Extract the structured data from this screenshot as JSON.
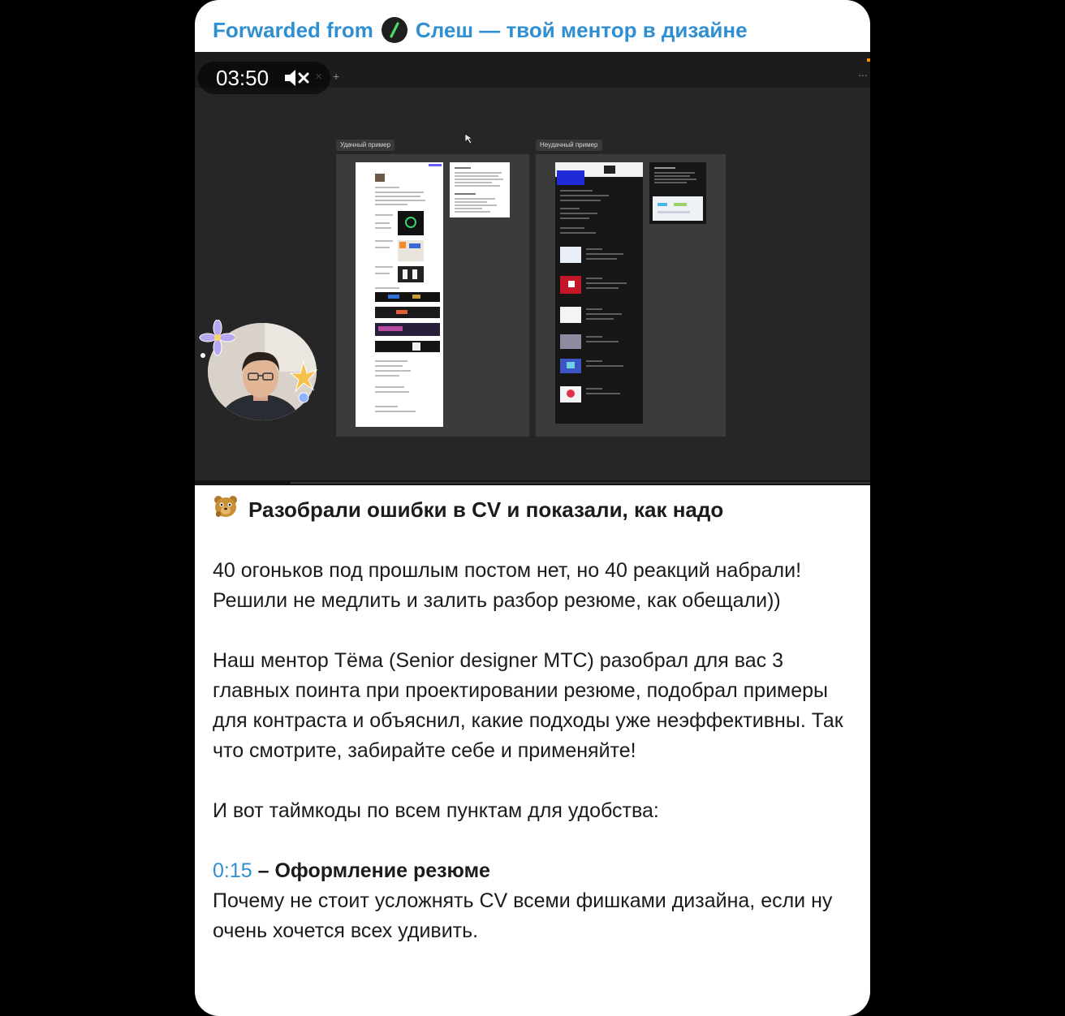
{
  "forward": {
    "prefix": "Forwarded from",
    "channel": "Слеш — твой ментор в дизайне",
    "avatar_icon": "slash-icon"
  },
  "video": {
    "duration": "03:50",
    "muted": true,
    "mute_icon": "speaker-muted-icon",
    "frames": [
      {
        "label": "Удачный пример"
      },
      {
        "label": "Неудачный пример"
      }
    ]
  },
  "post": {
    "emoji_icon": "bear-emoji-icon",
    "title": "Разобрали ошибки в CV и показали, как надо",
    "paragraph1": "40 огоньков под прошлым постом нет, но 40 реакций набрали! Решили не медлить и залить разбор резюме, как обещали))",
    "paragraph2": "Наш ментор Тёма (Senior designer МТС) разобрал для вас 3 главных поинта при проектировании резюме, подобрал примеры для контраста и объяснил, какие подходы уже неэффективны. Так что смотрите, забирайте себе и применяйте!",
    "paragraph3": "И вот таймкоды по всем пунктам для удобства:",
    "timecodes": [
      {
        "time": "0:15",
        "title": "– Оформление резюме",
        "description": "Почему не стоит усложнять CV всеми фишками дизайна, если ну очень хочется всех удивить."
      }
    ]
  },
  "colors": {
    "link": "#2f8fd1",
    "bubble": "#ffffff",
    "background": "#000000",
    "canvas": "#262626"
  }
}
